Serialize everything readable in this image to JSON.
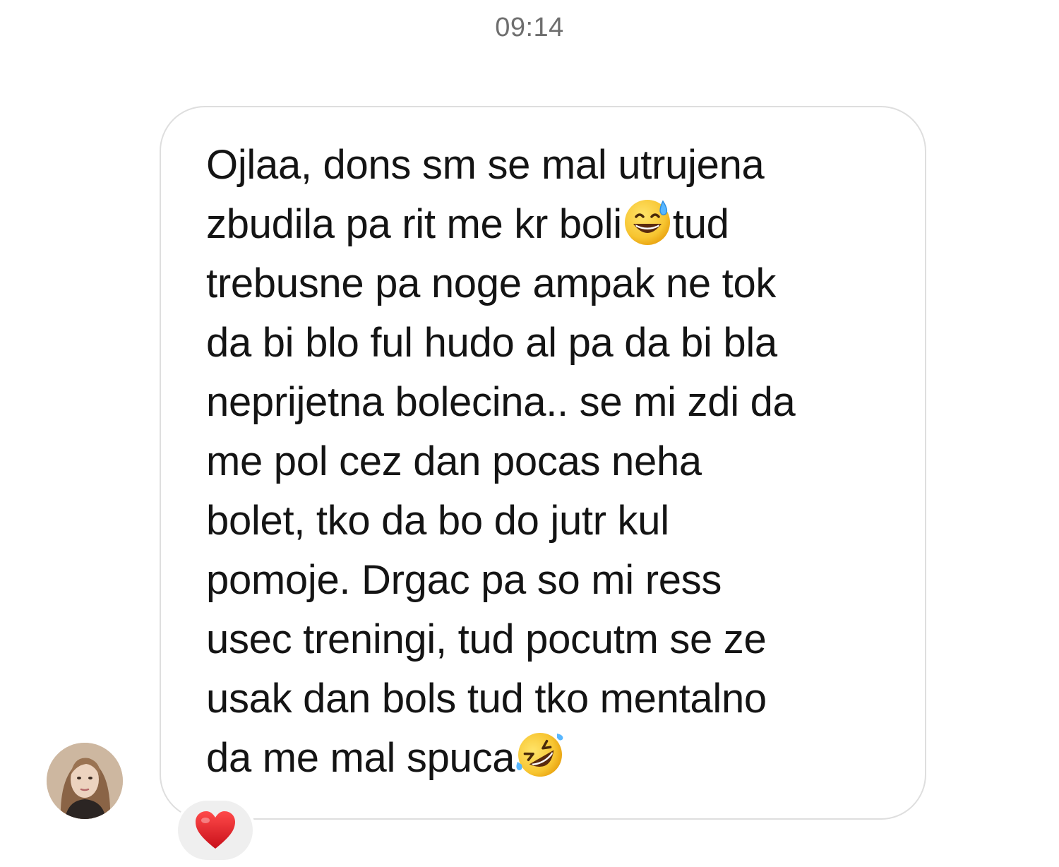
{
  "header": {
    "timestamp": "09:14"
  },
  "message": {
    "lines": [
      "Ojlaa, dons sm se mal utrujena",
      "zbudila pa rit me kr boli",
      "tud",
      "trebusne pa noge ampak ne tok",
      "da bi blo ful hudo al pa da bi bla",
      "neprijetna bolecina.. se mi zdi da",
      "me pol cez dan pocas neha",
      "bolet, tko da bo do jutr kul",
      "pomoje. Drgac pa so mi ress",
      "usec treningi, tud pocutm se ze",
      "usak dan bols tud tko mentalno",
      "da me mal spuca"
    ],
    "emojis": [
      "grinning-face-with-sweat-icon",
      "rolling-on-floor-laughing-icon"
    ]
  },
  "sender": {
    "avatar_icon": "profile-photo-avatar"
  },
  "reaction": {
    "icon": "red-heart-icon",
    "color": "#e0151f"
  },
  "colors": {
    "bubble_border": "#dedede",
    "text": "#141414",
    "timestamp": "#6e6e6e",
    "reaction_bg": "#efefef"
  }
}
